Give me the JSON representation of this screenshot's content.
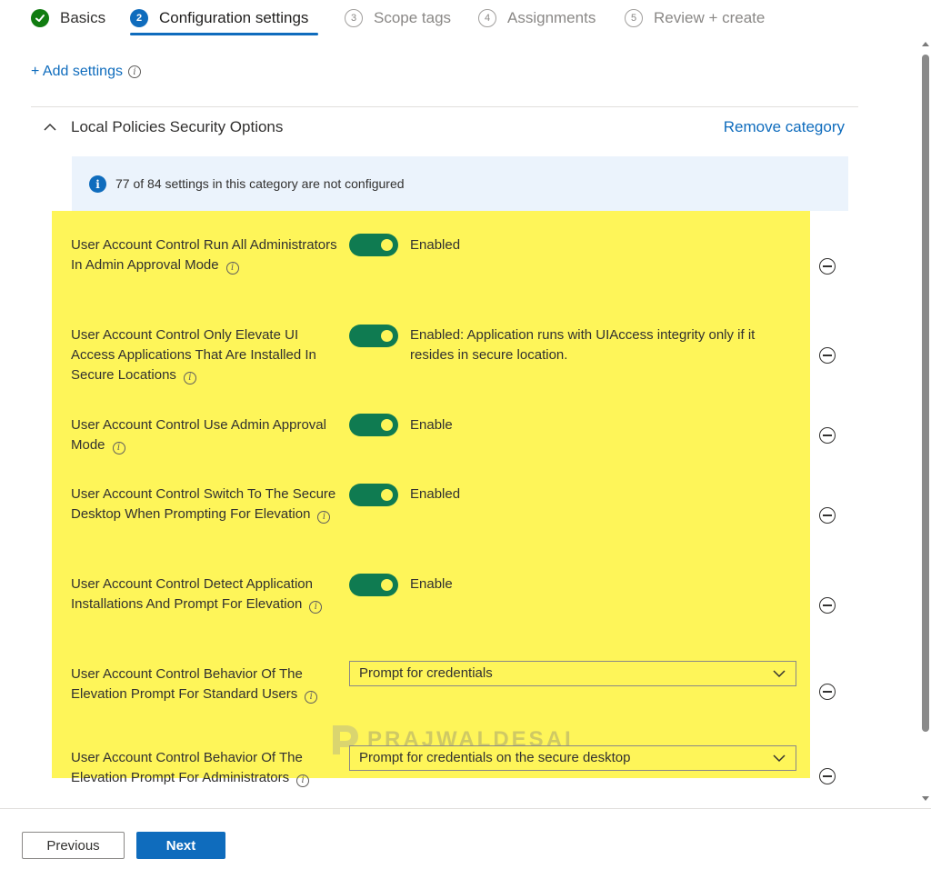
{
  "wizard": {
    "steps": [
      {
        "number": "",
        "label": "Basics",
        "state": "done"
      },
      {
        "number": "2",
        "label": "Configuration settings",
        "state": "active"
      },
      {
        "number": "3",
        "label": "Scope tags",
        "state": "pending"
      },
      {
        "number": "4",
        "label": "Assignments",
        "state": "pending"
      },
      {
        "number": "5",
        "label": "Review + create",
        "state": "pending"
      }
    ]
  },
  "add_settings_label": "+ Add settings",
  "category": {
    "title": "Local Policies Security Options",
    "remove_label": "Remove category",
    "info_message": "77 of 84 settings in this category are not configured"
  },
  "settings": [
    {
      "name": "User Account Control Run All Administrators In Admin Approval Mode",
      "value": "Enabled",
      "control": "toggle",
      "on": true
    },
    {
      "name": "User Account Control Only Elevate UI Access Applications That Are Installed In Secure Locations",
      "value": "Enabled: Application runs with UIAccess integrity only if it resides in secure location.",
      "control": "toggle",
      "on": true
    },
    {
      "name": "User Account Control Use Admin Approval Mode",
      "value": "Enable",
      "control": "toggle",
      "on": true
    },
    {
      "name": "User Account Control Switch To The Secure Desktop When Prompting For Elevation",
      "value": "Enabled",
      "control": "toggle",
      "on": true
    },
    {
      "name": "User Account Control Detect Application Installations And Prompt For Elevation",
      "value": "Enable",
      "control": "toggle",
      "on": true
    },
    {
      "name": "User Account Control Behavior Of The Elevation Prompt For Standard Users",
      "value": "Prompt for credentials",
      "control": "dropdown"
    },
    {
      "name": "User Account Control Behavior Of The Elevation Prompt For Administrators",
      "value": "Prompt for credentials on the secure desktop",
      "control": "dropdown"
    }
  ],
  "watermark": "PRAJWALDESAI",
  "footer": {
    "previous_label": "Previous",
    "next_label": "Next"
  },
  "colors": {
    "accent": "#0f6cbd",
    "highlight": "#fef559",
    "toggle_on": "#0f7b51",
    "success": "#107c10"
  }
}
